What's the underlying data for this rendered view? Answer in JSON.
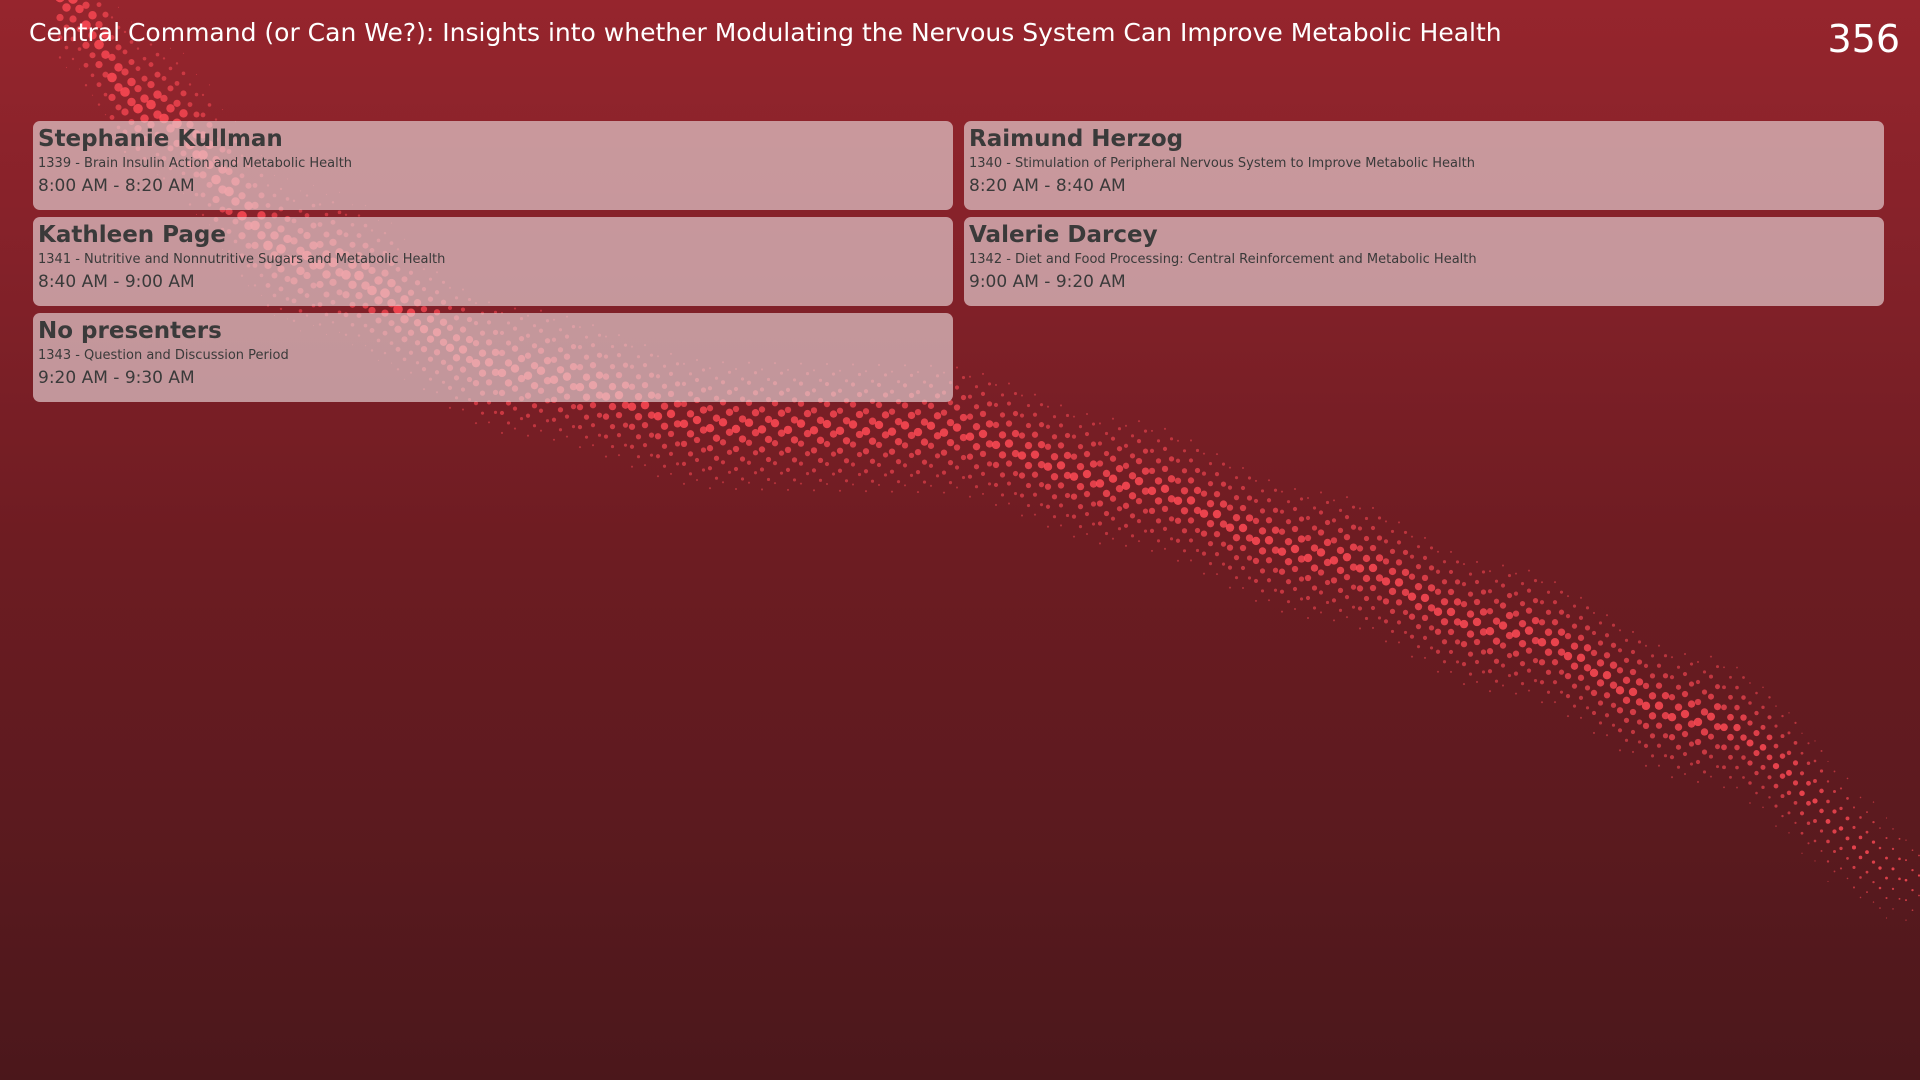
{
  "header": {
    "title": "Central Command (or Can We?): Insights into whether Modulating the Nervous System Can Improve Metabolic Health",
    "room": "356"
  },
  "sessions": [
    {
      "name": "Stephanie Kullman",
      "topic": "1339 - Brain Insulin Action and Metabolic Health",
      "time": "8:00 AM - 8:20 AM"
    },
    {
      "name": "Raimund Herzog",
      "topic": "1340 - Stimulation of Peripheral Nervous System to Improve Metabolic Health",
      "time": "8:20 AM - 8:40 AM"
    },
    {
      "name": "Kathleen Page",
      "topic": "1341 - Nutritive and Nonnutritive Sugars and Metabolic Health",
      "time": "8:40 AM - 9:00 AM"
    },
    {
      "name": "Valerie Darcey",
      "topic": "1342 - Diet and Food Processing: Central Reinforcement and Metabolic Health",
      "time": "9:00 AM - 9:20 AM"
    },
    {
      "name": "No presenters",
      "topic": "1343 - Question and Discussion Period",
      "time": "9:20 AM - 9:30 AM"
    }
  ],
  "theme": {
    "background_top": "#96252d",
    "background_bottom": "#4b171b",
    "card_background": "#e8d4d8",
    "card_text": "#3a3a3a",
    "dot_color": "#ff4a55"
  }
}
